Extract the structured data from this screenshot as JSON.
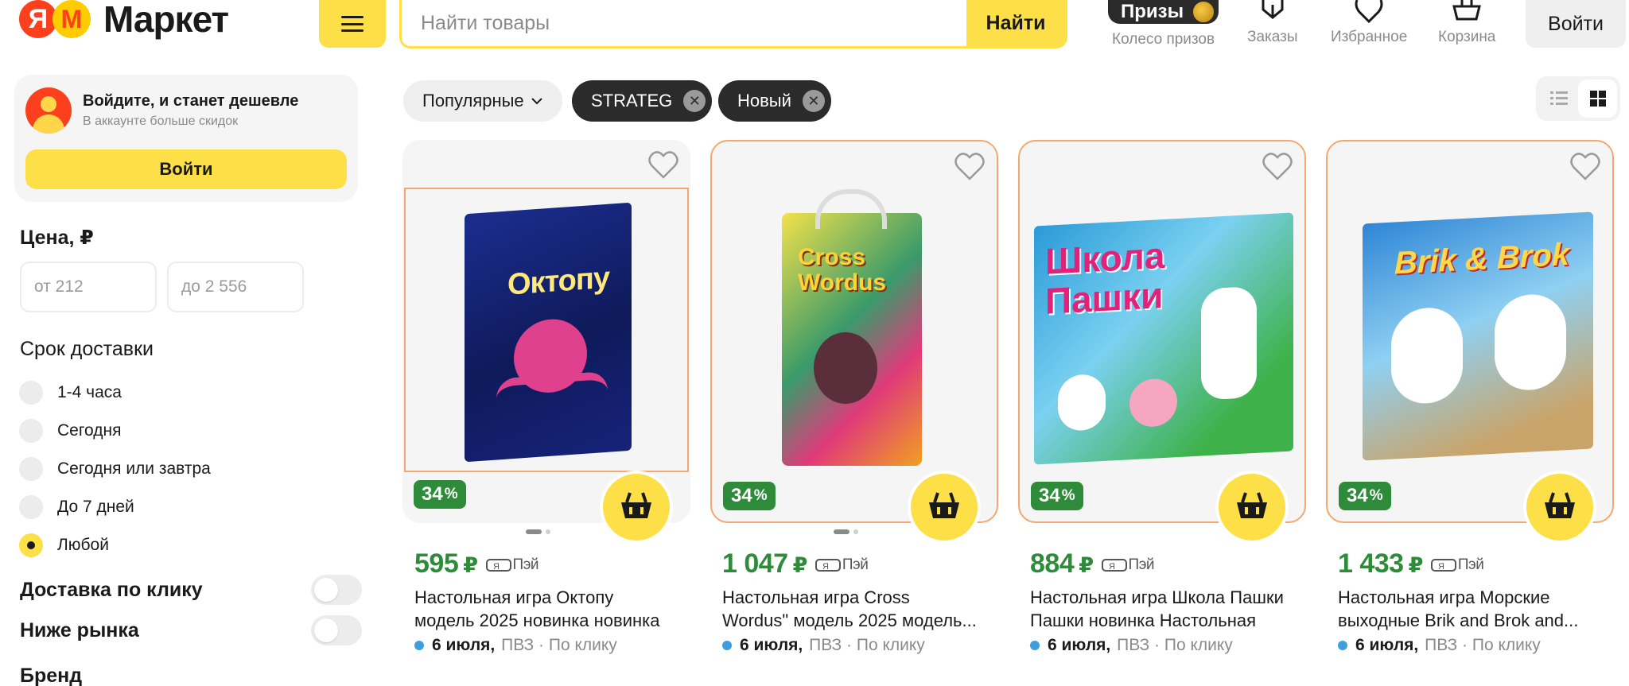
{
  "header": {
    "logo_text": "Маркет",
    "search_placeholder": "Найти товары",
    "search_button": "Найти",
    "prizes_pill": "Призы",
    "prizes_label": "Колесо призов",
    "orders_label": "Заказы",
    "favorites_label": "Избранное",
    "cart_label": "Корзина",
    "login_button": "Войти"
  },
  "sidebar": {
    "promo": {
      "title": "Войдите, и станет дешевле",
      "subtitle": "В аккаунте больше скидок",
      "button": "Войти"
    },
    "price": {
      "heading": "Цена, ₽",
      "from_placeholder": "от 212",
      "to_placeholder": "до 2 556"
    },
    "delivery": {
      "heading": "Срок доставки",
      "options": [
        "1-4 часа",
        "Сегодня",
        "Сегодня или завтра",
        "До 7 дней",
        "Любой"
      ],
      "selected": "Любой"
    },
    "toggles": [
      {
        "label": "Доставка по клику",
        "on": false
      },
      {
        "label": "Ниже рынка",
        "on": false
      }
    ],
    "brand_heading": "Бренд"
  },
  "filters": {
    "sort": "Популярные",
    "chips": [
      "STRATEG",
      "Новый"
    ]
  },
  "products": [
    {
      "discount": "34",
      "price": "595",
      "currency": "₽",
      "pay": "Пэй",
      "title_l1": "Настольная игра Октопу",
      "title_l2": "модель 2025 новинка новинка",
      "delivery_date": "6 июля,",
      "delivery_rest": "ПВЗ · По клику",
      "art_text": "Октопу"
    },
    {
      "discount": "34",
      "price": "1 047",
      "currency": "₽",
      "pay": "Пэй",
      "title_l1": "Настольная игра Cross",
      "title_l2": "Wordus\" модель 2025 модель...",
      "delivery_date": "6 июля,",
      "delivery_rest": "ПВЗ · По клику",
      "art_text": "Cross Wordus"
    },
    {
      "discount": "34",
      "price": "884",
      "currency": "₽",
      "pay": "Пэй",
      "title_l1": "Настольная игра Школа Пашки",
      "title_l2": "Пашки новинка Настольная",
      "delivery_date": "6 июля,",
      "delivery_rest": "ПВЗ · По клику",
      "art_text": "Школа Пашки"
    },
    {
      "discount": "34",
      "price": "1 433",
      "currency": "₽",
      "pay": "Пэй",
      "title_l1": "Настольная игра Морские",
      "title_l2": "выходные Brik and Brok and...",
      "delivery_date": "6 июля,",
      "delivery_rest": "ПВЗ · По клику",
      "art_text": "Brik & Brok"
    }
  ],
  "colors": {
    "accent_yellow": "#fde047",
    "discount_green": "#2e8b3a",
    "chip_dark": "#2b2b2b",
    "brand_red": "#fc3f1d"
  }
}
